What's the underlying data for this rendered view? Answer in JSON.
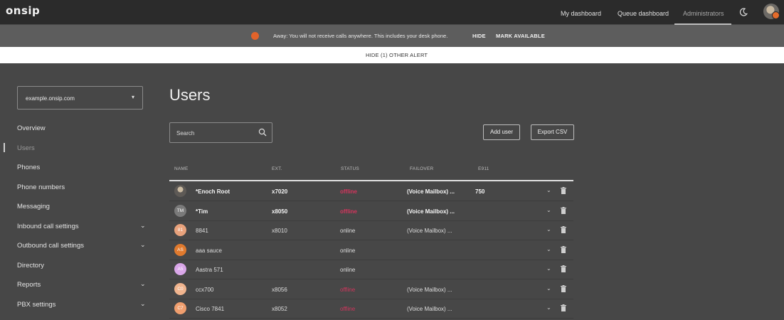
{
  "app": {
    "logo": "onsip"
  },
  "topnav": {
    "links": [
      "My dashboard",
      "Queue dashboard",
      "Administrators"
    ]
  },
  "alert": {
    "message": "Away: You will not receive calls anywhere. This includes your desk phone.",
    "hide": "HIDE",
    "mark_available": "MARK AVAILABLE",
    "hide_other": "HIDE (1) OTHER ALERT"
  },
  "sidebar": {
    "org": "example.onsip.com",
    "items": [
      {
        "label": "Overview",
        "expandable": false
      },
      {
        "label": "Users",
        "expandable": false
      },
      {
        "label": "Phones",
        "expandable": false
      },
      {
        "label": "Phone numbers",
        "expandable": false
      },
      {
        "label": "Messaging",
        "expandable": false
      },
      {
        "label": "Inbound call settings",
        "expandable": true
      },
      {
        "label": "Outbound call settings",
        "expandable": true
      },
      {
        "label": "Directory",
        "expandable": false
      },
      {
        "label": "Reports",
        "expandable": true
      },
      {
        "label": "PBX settings",
        "expandable": true
      }
    ]
  },
  "main": {
    "title": "Users",
    "search_placeholder": "Search",
    "add_user": "Add user",
    "export_csv": "Export CSV",
    "columns": [
      "NAME",
      "EXT.",
      "STATUS",
      "FAILOVER",
      "E911"
    ],
    "rows": [
      {
        "initials": "",
        "avatar_color": "photo",
        "name": "*Enoch Root",
        "ext": "x7020",
        "status": "offline",
        "failover": "(Voice Mailbox) ...",
        "e911": "750",
        "bold": true
      },
      {
        "initials": "TM",
        "avatar_color": "#7a7a7a",
        "name": "*Tim",
        "ext": "x8050",
        "status": "offline",
        "failover": "(Voice Mailbox) ...",
        "e911": "",
        "bold": true
      },
      {
        "initials": "81",
        "avatar_color": "#e8a27c",
        "name": "8841",
        "ext": "x8010",
        "status": "online",
        "failover": "(Voice Mailbox) ...",
        "e911": "",
        "bold": false
      },
      {
        "initials": "AS",
        "avatar_color": "#e07a2e",
        "name": "aaa sauce",
        "ext": "",
        "status": "online",
        "failover": "",
        "e911": "",
        "bold": false
      },
      {
        "initials": "A5",
        "avatar_color": "#d9a6e8",
        "name": "Aastra 571",
        "ext": "",
        "status": "online",
        "failover": "",
        "e911": "",
        "bold": false
      },
      {
        "initials": "C0",
        "avatar_color": "#f0b48e",
        "name": "ccx700",
        "ext": "x8056",
        "status": "offline",
        "failover": "(Voice Mailbox) ...",
        "e911": "",
        "bold": false
      },
      {
        "initials": "C7",
        "avatar_color": "#ef9e6e",
        "name": "Cisco 7841",
        "ext": "x8052",
        "status": "offline",
        "failover": "(Voice Mailbox) ...",
        "e911": "",
        "bold": false
      }
    ]
  },
  "colors": {
    "offline": "#d2355d",
    "alert_dot": "#e2632a"
  }
}
